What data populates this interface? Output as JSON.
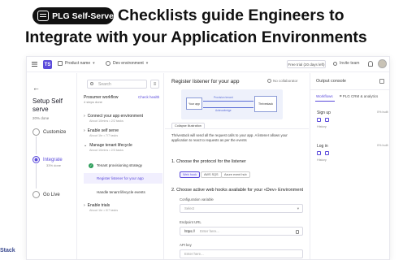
{
  "hero": {
    "badge": "PLG Self-Serve",
    "line1": "Checklists guide Engineers to",
    "line2": "Integrate with your Application Environments"
  },
  "topbar": {
    "logo": "TS",
    "product": "Product name",
    "environment": "Dev environment",
    "trial": "Free trial (20 days left)",
    "invite": "Invite team"
  },
  "left": {
    "title": "Setup Self serve",
    "pct": "20% done",
    "steps": [
      {
        "label": "Customize",
        "sub": ""
      },
      {
        "label": "Integrate",
        "sub": "33% done"
      },
      {
        "label": "Go Live",
        "sub": ""
      }
    ]
  },
  "checklist": {
    "search_placeholder": "Search",
    "workflow_title": "Prosumer workflow",
    "workflow_health": "Check health",
    "workflow_steps": "4 steps done",
    "groups": [
      {
        "label": "Connect your app environment",
        "sub": "About 10mins • 2/2 tasks"
      },
      {
        "label": "Enable self serve",
        "sub": "About 1hr • 7/7 tasks"
      },
      {
        "label": "Manage tenant lifecycle",
        "sub": "About 10mins • 2/3 tasks"
      },
      {
        "label": "Enable trials",
        "sub": "About 1hr • 0/7 tasks"
      }
    ],
    "tasks": [
      "Tenant provisioning strategy",
      "Register listener for your app",
      "Handle tenant lifecycle events"
    ]
  },
  "main": {
    "title": "Register listener for your app",
    "collaborator": "No collaborator",
    "diagram": {
      "app": "Your app",
      "thrivestack": "Thrivestack",
      "event": "Provision tenant",
      "ack": "Acknowledge"
    },
    "collapse": "Collapse illustration",
    "description": "Thrivestack will send all the request calls to your app. A listener allows your application to react to requests as per the events",
    "q1": "1.  Choose the protocol for the listener",
    "chips": [
      "Web hook",
      "AWS SQS",
      "Azure event hub"
    ],
    "q2": "2.  Choose active web hooks available for your «Dev» Environment",
    "config_label": "Configuration variable",
    "config_value": "Select",
    "endpoint_label": "Endpoint URL",
    "endpoint_prefix": "https://",
    "endpoint_placeholder": "Enter here...",
    "apikey_label": "API key",
    "apikey_placeholder": "Enter here..."
  },
  "right": {
    "title": "Output console",
    "tabs": [
      "Workflows",
      "PLG CRM & analytics"
    ],
    "workflows": [
      {
        "name": "Sign up",
        "built": "0% built",
        "history": "History"
      },
      {
        "name": "Log in",
        "built": "0% built",
        "history": "History"
      }
    ]
  },
  "footer_cropped": "Stack",
  "colors": {
    "accent": "#5b4bdb",
    "success": "#2e9e5b"
  }
}
